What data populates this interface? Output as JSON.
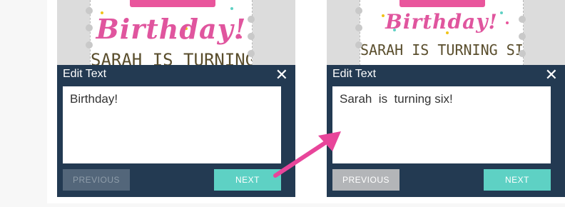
{
  "left_panel": {
    "card": {
      "title": "Birthday!",
      "subtitle": "SARAH IS TURNING SIX!"
    },
    "dialog": {
      "title": "Edit Text",
      "close_label": "✕",
      "text_value": "Birthday!",
      "previous_label": "PREVIOUS",
      "next_label": "NEXT",
      "previous_state": "disabled"
    }
  },
  "right_panel": {
    "card": {
      "title": "Birthday!",
      "subtitle": "SARAH IS TURNING SIX!"
    },
    "dialog": {
      "title": "Edit Text",
      "close_label": "✕",
      "text_value": "Sarah  is  turning six!",
      "previous_label": "PREVIOUS",
      "next_label": "NEXT",
      "previous_state": "enabled"
    }
  },
  "colors": {
    "dialog_bg": "#233a52",
    "next_button": "#5ed1c4",
    "card_title": "#e0559e",
    "arrow": "#e8459a"
  },
  "icons": {
    "close": "close-icon",
    "annotation": "pink-arrow"
  }
}
